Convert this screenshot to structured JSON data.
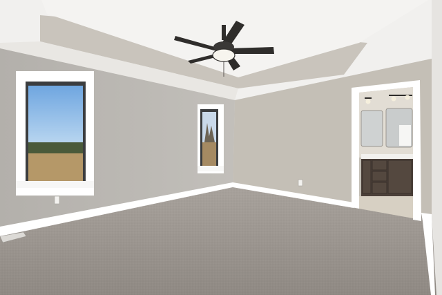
{
  "scene": {
    "kind": "empty-bedroom-photo",
    "elements": [
      "tray-ceiling",
      "ceiling-fan",
      "left-window",
      "center-window",
      "bathroom-doorway",
      "vanity",
      "carpet-floor",
      "baseboards",
      "wall-outlets",
      "floor-vent"
    ]
  },
  "colors": {
    "ceiling": "#f1f0ee",
    "tray": "#c9c4bc",
    "wall_left": "#b8b5b0",
    "wall_back": "#c4bfb6",
    "wall_right": "#e6e4e1",
    "trim": "#ffffff",
    "carpet": "#9b958f",
    "window_frame": "#3b3d3f",
    "sky": "#7fb3e6",
    "field": "#b59868",
    "vanity_wood": "#4b4039",
    "fan_body": "#2f2d2b"
  }
}
